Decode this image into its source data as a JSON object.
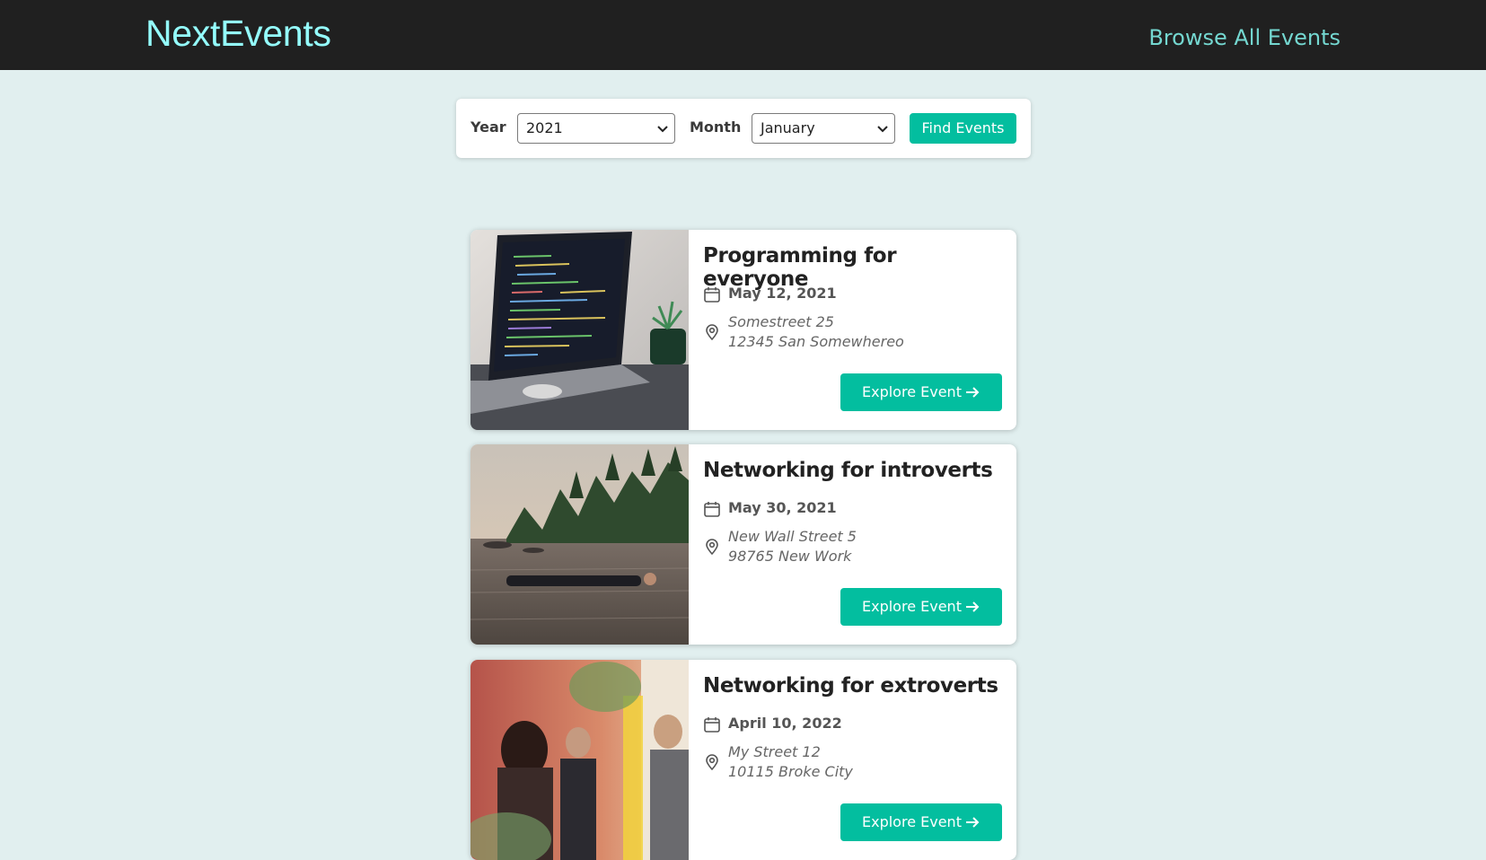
{
  "header": {
    "logo": "NextEvents",
    "nav_link": "Browse All Events"
  },
  "search": {
    "year_label": "Year",
    "year_value": "2021",
    "month_label": "Month",
    "month_value": "January",
    "submit_label": "Find Events"
  },
  "events": [
    {
      "title": "Programming for everyone",
      "date": "May 12, 2021",
      "address_line1": "Somestreet 25",
      "address_line2": "12345 San Somewhereo",
      "button_label": "Explore Event",
      "image": "laptop-with-code-photo"
    },
    {
      "title": "Networking for introverts",
      "date": "May 30, 2021",
      "address_line1": "New Wall Street 5",
      "address_line2": "98765 New Work",
      "button_label": "Explore Event",
      "image": "person-floating-in-lake-photo"
    },
    {
      "title": "Networking for extroverts",
      "date": "April 10, 2022",
      "address_line1": "My Street 12",
      "address_line2": "10115 Broke City",
      "button_label": "Explore Event",
      "image": "people-networking-photo"
    }
  ],
  "colors": {
    "accent": "#03be9f",
    "header_bg": "#202020",
    "logo": "#94fdfd",
    "nav_link": "#74d7d0",
    "page_bg": "#e1efef"
  }
}
